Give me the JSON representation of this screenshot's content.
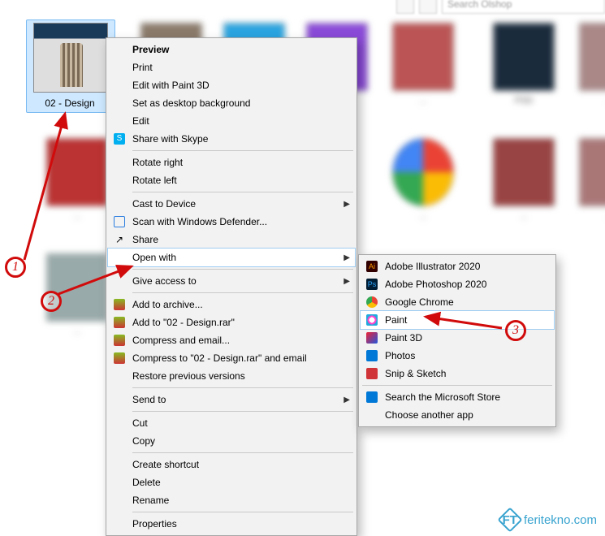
{
  "top": {
    "search_placeholder": "Search Olshop"
  },
  "selected_file": {
    "label": "02 - Design"
  },
  "menu1": {
    "preview": "Preview",
    "print": "Print",
    "edit_paint3d": "Edit with Paint 3D",
    "set_bg": "Set as desktop background",
    "edit": "Edit",
    "share_skype": "Share with Skype",
    "rotate_right": "Rotate right",
    "rotate_left": "Rotate left",
    "cast": "Cast to Device",
    "defender": "Scan with Windows Defender...",
    "share": "Share",
    "open_with": "Open with",
    "give_access": "Give access to",
    "add_archive": "Add to archive...",
    "add_to_rar": "Add to \"02 - Design.rar\"",
    "compress_email": "Compress and email...",
    "compress_rar_email": "Compress to \"02 - Design.rar\" and email",
    "restore": "Restore previous versions",
    "send_to": "Send to",
    "cut": "Cut",
    "copy": "Copy",
    "create_shortcut": "Create shortcut",
    "delete": "Delete",
    "rename": "Rename",
    "properties": "Properties"
  },
  "menu2": {
    "ai": "Adobe Illustrator 2020",
    "ps": "Adobe Photoshop 2020",
    "chrome": "Google Chrome",
    "paint": "Paint",
    "paint3d": "Paint 3D",
    "photos": "Photos",
    "snip": "Snip & Sketch",
    "store": "Search the Microsoft Store",
    "choose": "Choose another app"
  },
  "annotations": {
    "n1": "1",
    "n2": "2",
    "n3": "3"
  },
  "watermark": {
    "text": "feritekno.com",
    "initials": "FT"
  }
}
